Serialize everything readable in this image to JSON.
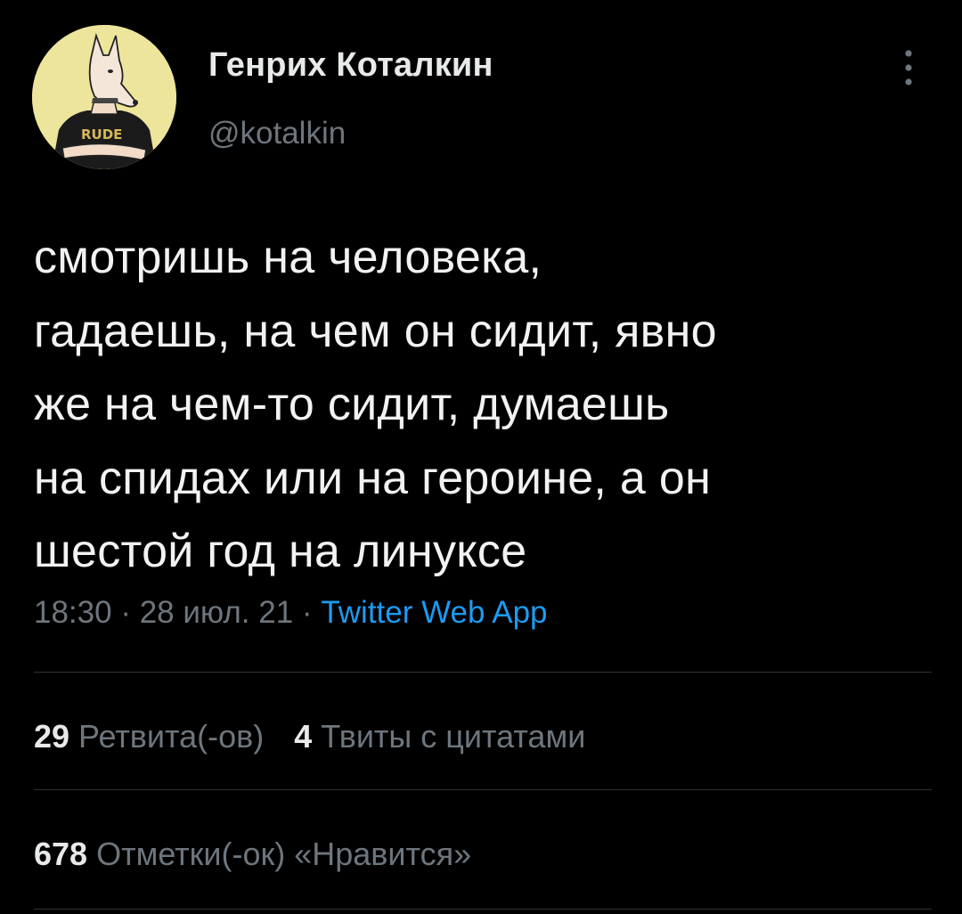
{
  "user": {
    "display_name": "Генрих Коталкин",
    "handle": "@kotalkin",
    "avatar_text": "RUDE",
    "avatar_bg": "#ece59b"
  },
  "menu_icon": "more-vertical-icon",
  "tweet": {
    "lines": [
      "смотришь на человека,",
      "гадаешь, на чем он сидит, явно",
      "же на чем-то сидит, думаешь",
      "на спидах или на героине, а он",
      "шестой год на линуксе"
    ]
  },
  "meta": {
    "time": "18:30",
    "separator1": " · ",
    "date": "28 июл. 21",
    "separator2": " · ",
    "source": "Twitter Web App"
  },
  "stats": {
    "retweets_count": "29",
    "retweets_label": "Ретвита(-ов)",
    "quotes_count": "4",
    "quotes_label": "Твиты с цитатами",
    "likes_count": "678",
    "likes_label": "Отметки(-ок) «Нравится»"
  },
  "colors": {
    "background": "#000000",
    "text": "#e7e9ea",
    "secondary": "#6e767d",
    "link": "#1d9bf0",
    "divider": "#2f3336"
  }
}
